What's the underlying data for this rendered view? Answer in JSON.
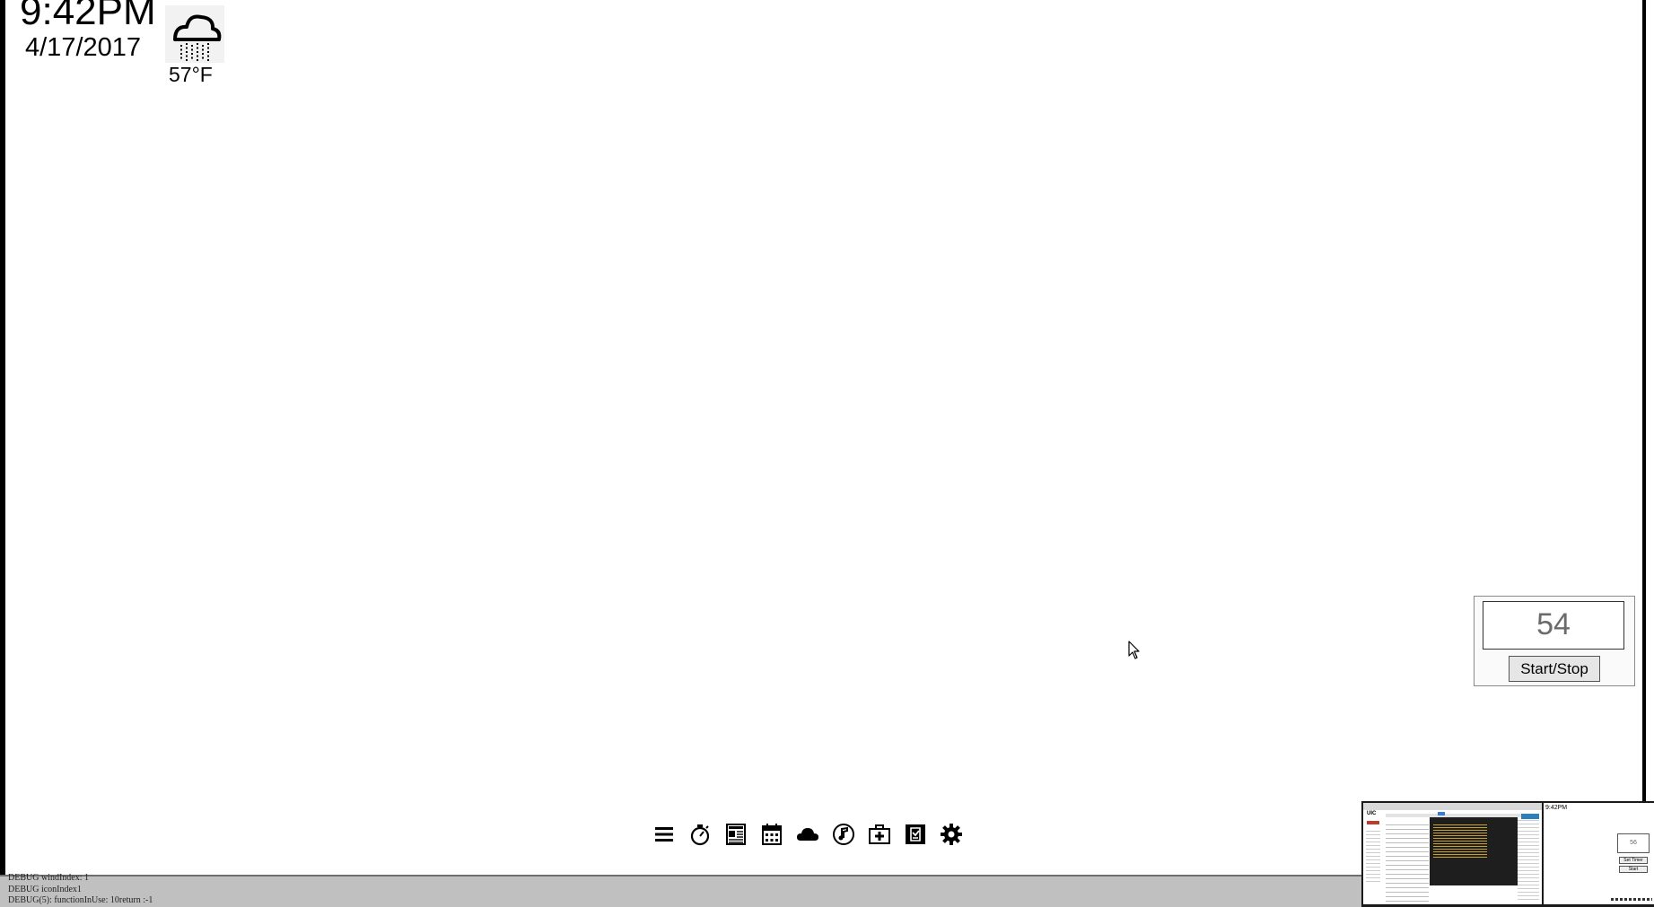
{
  "clock": {
    "time": "9:42PM",
    "date": "4/17/2017"
  },
  "weather": {
    "icon": "rain-cloud-icon",
    "temperature": "57°F"
  },
  "timer": {
    "value": "54",
    "button_label": "Start/Stop"
  },
  "dock": {
    "items": [
      {
        "name": "menu-icon"
      },
      {
        "name": "stopwatch-icon"
      },
      {
        "name": "news-icon"
      },
      {
        "name": "calendar-icon"
      },
      {
        "name": "cloud-icon"
      },
      {
        "name": "music-icon"
      },
      {
        "name": "health-kit-icon"
      },
      {
        "name": "notes-icon"
      },
      {
        "name": "settings-gear-icon"
      }
    ]
  },
  "debug": {
    "lines": [
      "DEBUG windIndex: 1",
      "DEBUG iconIndex1",
      "DEBUG(5): functionInUse: 10return :-1"
    ]
  },
  "taskbar_previews": {
    "window_1": {
      "app_label": "UIC"
    },
    "window_2": {
      "time": "9:42PM",
      "timer_value": "56",
      "button_1": "Set Timer",
      "button_2": "Start"
    }
  },
  "colors": {
    "background": "#ffffff",
    "debug_bar": "#c0c0c0",
    "border": "#000000",
    "timer_digits": "#6b6b6b"
  }
}
